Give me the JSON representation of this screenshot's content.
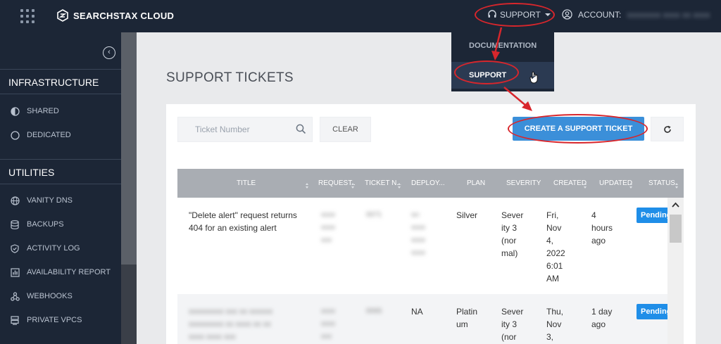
{
  "topbar": {
    "brand": "SEARCHSTAX CLOUD",
    "support_label": "SUPPORT",
    "account_label": "ACCOUNT:",
    "account_value": "xxxxxxxx xxxx xx xxxx"
  },
  "dropdown": {
    "items": [
      {
        "label": "DOCUMENTATION"
      },
      {
        "label": "SUPPORT"
      }
    ]
  },
  "sidebar": {
    "infrastructure_heading": "INFRASTRUCTURE",
    "infrastructure": [
      {
        "label": "SHARED",
        "icon": "shared-icon"
      },
      {
        "label": "DEDICATED",
        "icon": "dedicated-icon"
      }
    ],
    "utilities_heading": "UTILITIES",
    "utilities": [
      {
        "label": "VANITY DNS",
        "icon": "globe-icon"
      },
      {
        "label": "BACKUPS",
        "icon": "database-icon"
      },
      {
        "label": "ACTIVITY LOG",
        "icon": "shield-icon"
      },
      {
        "label": "AVAILABILITY REPORT",
        "icon": "chart-icon"
      },
      {
        "label": "WEBHOOKS",
        "icon": "webhook-icon"
      },
      {
        "label": "PRIVATE VPCS",
        "icon": "server-icon"
      }
    ]
  },
  "main": {
    "title": "SUPPORT TICKETS",
    "search_placeholder": "Ticket Number",
    "clear_label": "CLEAR",
    "create_label": "CREATE A SUPPORT TICKET"
  },
  "table": {
    "columns": [
      "TITLE",
      "REQUEST...",
      "TICKET N...",
      "DEPLOY...",
      "PLAN",
      "SEVERITY",
      "CREATED",
      "UPDATED",
      "STATUS"
    ],
    "rows": [
      {
        "title_l1": "\"Delete alert\" request returns",
        "title_l2": "404 for an existing alert",
        "requester": [
          "xxxx",
          "xxxx",
          "xxx"
        ],
        "ticket": "0071",
        "deployment": [
          "xx-",
          "xxxx",
          "xxxx",
          "xxxx"
        ],
        "plan": "Silver",
        "severity": [
          "Sever",
          "ity 3",
          "(nor",
          "mal)"
        ],
        "created": [
          "Fri,",
          "Nov",
          "4,",
          "2022",
          "6:01",
          "AM"
        ],
        "updated": [
          "4",
          "hours",
          "ago"
        ],
        "status": "Pending"
      },
      {
        "title_l1": "xxxxxxxxx xxx xx xxxxxx",
        "title_l2": "xxxxxxxxx xx xxxx xx xx",
        "title_l3": "xxxx xxxx xxx",
        "requester": [
          "xxxx",
          "xxxx",
          "xxx"
        ],
        "ticket": "0065",
        "deployment": [
          "NA"
        ],
        "plan": [
          "Platin",
          "um"
        ],
        "severity": [
          "Sever",
          "ity 3",
          "(nor"
        ],
        "created": [
          "Thu,",
          "Nov",
          "3,"
        ],
        "updated": [
          "1 day",
          "ago"
        ],
        "status": "Pending"
      }
    ]
  },
  "colors": {
    "topbar": "#1c2636",
    "accent": "#3b8fd9",
    "badge": "#1f8ee8",
    "annotation": "#d8262c"
  }
}
